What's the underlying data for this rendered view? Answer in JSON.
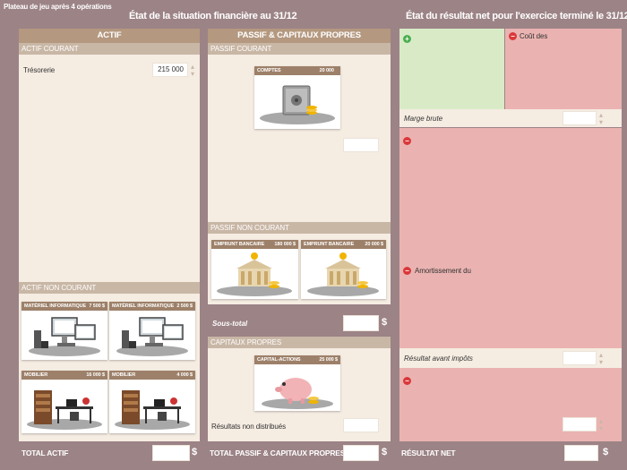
{
  "header": {
    "board_title": "Plateau de jeu après 4 opérations",
    "balance_title": "État de la situation financière au 31/12",
    "income_title": "État du résultat net pour l'exercice terminé le 31/12"
  },
  "actif": {
    "title": "ACTIF",
    "current_section": "ACTIF COURANT",
    "tresorerie_label": "Trésorerie",
    "tresorerie_value": "215 000",
    "noncurrent_section": "ACTIF NON COURANT",
    "cards": [
      {
        "name": "MATÉRIEL INFORMATIQUE",
        "amount": "7 500 $",
        "icon": "computer-icon"
      },
      {
        "name": "MATÉRIEL INFORMATIQUE",
        "amount": "2 500 $",
        "icon": "computer-icon"
      },
      {
        "name": "MOBILIER",
        "amount": "16 000 $",
        "icon": "office-furniture-icon"
      },
      {
        "name": "MOBILIER",
        "amount": "4 000 $",
        "icon": "office-furniture-icon"
      }
    ],
    "total_label": "TOTAL ACTIF",
    "total_value": "",
    "currency": "$"
  },
  "passif": {
    "title": "PASSIF & CAPITAUX PROPRES",
    "current_section": "PASSIF COURANT",
    "current_card": {
      "name": "COMPTES FOURNISSEURS",
      "amount": "20 000 $",
      "icon": "safe-icon"
    },
    "current_value": "",
    "noncurrent_section": "PASSIF NON COURANT",
    "noncurrent_cards": [
      {
        "name": "EMPRUNT BANCAIRE",
        "amount": "180 000 $",
        "icon": "bank-icon"
      },
      {
        "name": "EMPRUNT BANCAIRE",
        "amount": "20 000 $",
        "icon": "bank-icon"
      }
    ],
    "subtotal_label": "Sous-total",
    "subtotal_value": "",
    "equity_section": "CAPITAUX PROPRES",
    "equity_card": {
      "name": "CAPITAL-ACTIONS",
      "amount": "25 000 $",
      "icon": "piggy-bank-icon"
    },
    "retained_label": "Résultats non distribués",
    "retained_value": "",
    "total_label": "TOTAL PASSIF & CAPITAUX PROPRES",
    "total_value": "",
    "currency": "$"
  },
  "resultat": {
    "cost_label": "Coût des",
    "gross_margin_label": "Marge brute",
    "gross_margin_value": "",
    "amortization_label": "Amortissement du",
    "pretax_label": "Résultat avant impôts",
    "pretax_value": "",
    "tax_value": "",
    "net_label": "RÉSULTAT NET",
    "net_value": "",
    "currency": "$"
  },
  "colors": {
    "background": "#9c8386",
    "header": "#b4987f",
    "panel": "#f5ece2",
    "green": "#d8ebc6",
    "red": "#eab3b1"
  }
}
